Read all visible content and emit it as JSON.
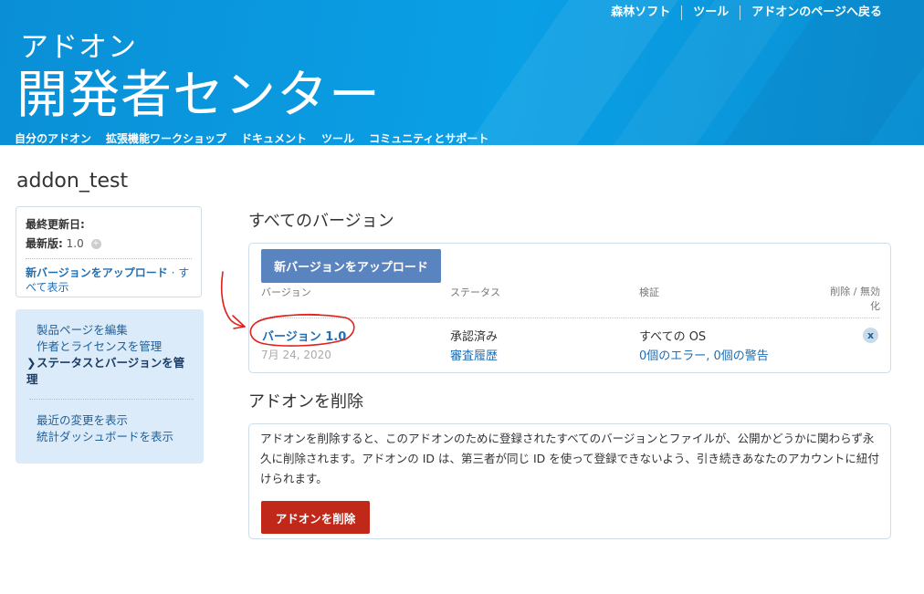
{
  "header": {
    "top_links": [
      "森林ソフト",
      "ツール",
      "アドオンのページへ戻る"
    ],
    "brand_small": "アドオン",
    "brand_big": "開発者センター",
    "nav": [
      "自分のアドオン",
      "拡張機能ワークショップ",
      "ドキュメント",
      "ツール",
      "コミュニティとサポート"
    ]
  },
  "page_title": "addon_test",
  "info": {
    "last_updated_label": "最終更新日:",
    "latest_label": "最新版:",
    "latest_value": "1.0",
    "upload_link": "新バージョンをアップロード",
    "dot": " · ",
    "all_link": "すべて表示"
  },
  "sidebar": {
    "group1": [
      "製品ページを編集",
      "作者とライセンスを管理"
    ],
    "current": "ステータスとバージョンを管理",
    "current_marker": "❯",
    "group2": [
      "最近の変更を表示",
      "統計ダッシュボードを表示"
    ]
  },
  "versions": {
    "heading": "すべてのバージョン",
    "upload_button": "新バージョンをアップロード",
    "columns": [
      "バージョン",
      "ステータス",
      "検証",
      "削除 / 無効化"
    ],
    "rows": [
      {
        "version": "バージョン 1.0",
        "date": "7月 24, 2020",
        "status": "承認済み",
        "history": "審査履歴",
        "os": "すべての OS",
        "validation": "0個のエラー, 0個の警告",
        "delete": "x"
      }
    ]
  },
  "delete": {
    "heading": "アドオンを削除",
    "text": "アドオンを削除すると、このアドオンのために登録されたすべてのバージョンとファイルが、公開かどうかに関わらず永久に削除されます。アドオンの ID は、第三者が同じ ID を使って登録できないよう、引き続きあなたのアカウントに紐付けられます。",
    "button": "アドオンを削除"
  },
  "colors": {
    "header_blue": "#0a98de",
    "link_blue": "#1f6fb5",
    "upload_button": "#5a84c0",
    "delete_button": "#c0281a",
    "sidebar_bg": "#dcebf9",
    "annotation_red": "#e0201a"
  }
}
